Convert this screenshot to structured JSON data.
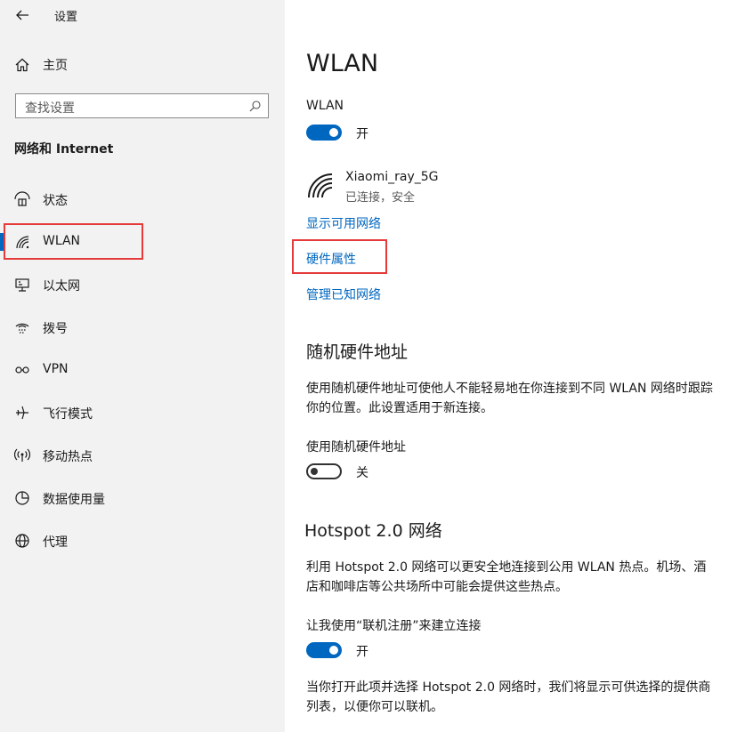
{
  "window": {
    "title": "设置"
  },
  "sidebar": {
    "home_label": "主页",
    "search_placeholder": "查找设置",
    "section_title": "网络和 Internet",
    "items": [
      {
        "label": "状态",
        "icon": "status-icon"
      },
      {
        "label": "WLAN",
        "icon": "wifi-icon",
        "selected": true
      },
      {
        "label": "以太网",
        "icon": "ethernet-icon"
      },
      {
        "label": "拨号",
        "icon": "dialup-icon"
      },
      {
        "label": "VPN",
        "icon": "vpn-icon"
      },
      {
        "label": "飞行模式",
        "icon": "airplane-icon"
      },
      {
        "label": "移动热点",
        "icon": "hotspot-icon"
      },
      {
        "label": "数据使用量",
        "icon": "data-usage-icon"
      },
      {
        "label": "代理",
        "icon": "globe-icon"
      }
    ]
  },
  "main": {
    "title": "WLAN",
    "wlan_toggle": {
      "label": "WLAN",
      "state": "开"
    },
    "network": {
      "name": "Xiaomi_ray_5G",
      "status": "已连接，安全"
    },
    "links": {
      "show_available": "显示可用网络",
      "hardware_properties": "硬件属性",
      "manage_known": "管理已知网络"
    },
    "random_mac": {
      "heading": "随机硬件地址",
      "description": "使用随机硬件地址可使他人不能轻易地在你连接到不同 WLAN 网络时跟踪你的位置。此设置适用于新连接。",
      "toggle_label": "使用随机硬件地址",
      "state": "关"
    },
    "hotspot2": {
      "heading": "Hotspot 2.0 网络",
      "description": "利用 Hotspot 2.0 网络可以更安全地连接到公用 WLAN 热点。机场、酒店和咖啡店等公共场所中可能会提供这些热点。",
      "toggle_label": "让我使用“联机注册”来建立连接",
      "state": "开",
      "footer": "当你打开此项并选择 Hotspot 2.0 网络时，我们将显示可供选择的提供商列表，以便你可以联机。"
    }
  },
  "colors": {
    "accent": "#0067c0",
    "highlight": "#e53a3a",
    "sidebar_bg": "#f2f2f2"
  }
}
